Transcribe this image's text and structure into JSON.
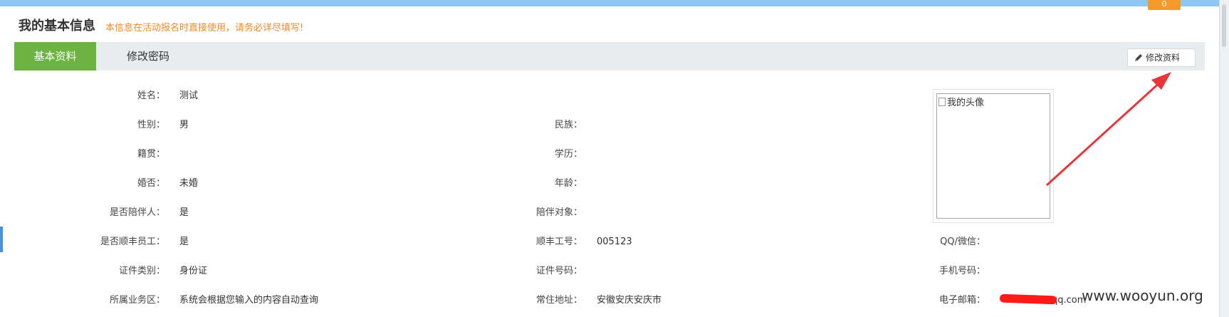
{
  "top_badge": "0",
  "page": {
    "title": "我的基本信息",
    "hint": "本信息在活动报名时直接使用，请务必详尽填写!"
  },
  "tabs": [
    {
      "label": "基本资料",
      "active": true
    },
    {
      "label": "修改密码",
      "active": false
    }
  ],
  "edit_button": {
    "label": "修改资料",
    "icon": "pencil-icon"
  },
  "fields": {
    "name": {
      "label": "姓名：",
      "value": "测试"
    },
    "gender": {
      "label": "性别：",
      "value": "男"
    },
    "native_place": {
      "label": "籍贯：",
      "value": ""
    },
    "marital": {
      "label": "婚否：",
      "value": "未婚"
    },
    "companion": {
      "label": "是否陪伴人：",
      "value": "是"
    },
    "sf_employee": {
      "label": "是否顺丰员工：",
      "value": "是"
    },
    "id_type": {
      "label": "证件类别：",
      "value": "身份证"
    },
    "business_area": {
      "label": "所属业务区：",
      "value": "系统会根据您输入的内容自动查询"
    },
    "ethnicity": {
      "label": "民族：",
      "value": ""
    },
    "education": {
      "label": "学历：",
      "value": ""
    },
    "age": {
      "label": "年龄：",
      "value": ""
    },
    "companion_target": {
      "label": "陪伴对象：",
      "value": ""
    },
    "sf_employee_no": {
      "label": "顺丰工号：",
      "value": "005123"
    },
    "id_number": {
      "label": "证件号码：",
      "value": ""
    },
    "address": {
      "label": "常住地址：",
      "value": "安徽安庆安庆市"
    },
    "qq_wechat": {
      "label": "QQ/微信：",
      "value": ""
    },
    "phone": {
      "label": "手机号码：",
      "value": ""
    },
    "email": {
      "label": "电子邮箱：",
      "value": "qq.com"
    }
  },
  "avatar": {
    "alt": "我的头像"
  },
  "watermark": "www.wooyun.org",
  "colors": {
    "tab_active": "#6db33f",
    "hint": "#f08a24",
    "topbar": "#8cc7f1",
    "annotation_arrow": "#e8353a"
  }
}
